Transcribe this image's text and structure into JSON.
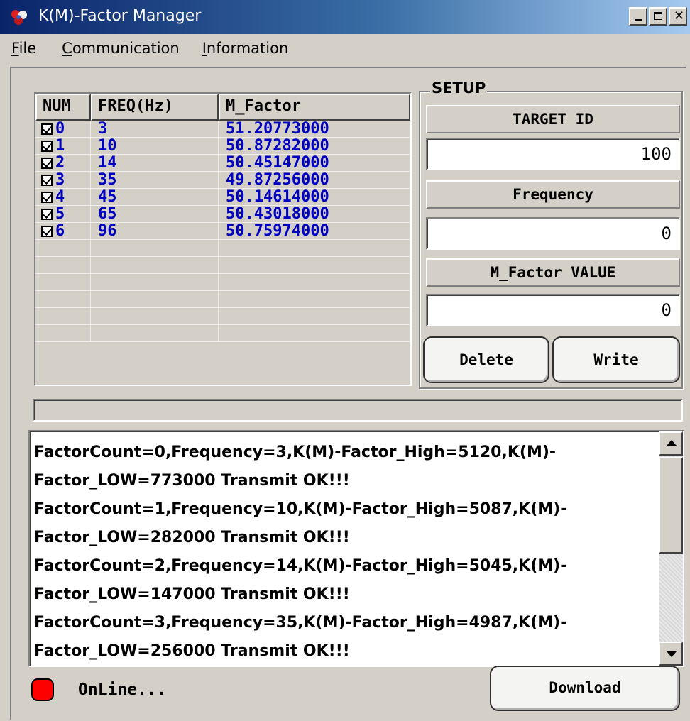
{
  "window": {
    "title": "K(M)-Factor Manager"
  },
  "menu": [
    {
      "label": "File"
    },
    {
      "label": "Communication"
    },
    {
      "label": "Information"
    }
  ],
  "grid": {
    "headers": [
      "NUM",
      "FREQ(Hz)",
      "M_Factor"
    ],
    "rows": [
      {
        "num": "0",
        "freq": "3",
        "factor": "51.20773000",
        "checked": true
      },
      {
        "num": "1",
        "freq": "10",
        "factor": "50.87282000",
        "checked": true
      },
      {
        "num": "2",
        "freq": "14",
        "factor": "50.45147000",
        "checked": true
      },
      {
        "num": "3",
        "freq": "35",
        "factor": "49.87256000",
        "checked": true
      },
      {
        "num": "4",
        "freq": "45",
        "factor": "50.14614000",
        "checked": true
      },
      {
        "num": "5",
        "freq": "65",
        "factor": "50.43018000",
        "checked": true
      },
      {
        "num": "6",
        "freq": "96",
        "factor": "50.75974000",
        "checked": true
      }
    ]
  },
  "setup": {
    "legend": "SETUP",
    "target_label": "TARGET ID",
    "target_value": "100",
    "frequency_label": "Frequency",
    "frequency_value": "0",
    "mfactor_label": "M_Factor VALUE",
    "mfactor_value": "0",
    "delete_label": "Delete",
    "write_label": "Write"
  },
  "progress": {
    "value": 0
  },
  "log": {
    "lines": [
      "FactorCount=0,Frequency=3,K(M)-Factor_High=5120,K(M)-",
      "Factor_LOW=773000 Transmit OK!!!",
      "FactorCount=1,Frequency=10,K(M)-Factor_High=5087,K(M)-",
      "Factor_LOW=282000 Transmit OK!!!",
      "FactorCount=2,Frequency=14,K(M)-Factor_High=5045,K(M)-",
      "Factor_LOW=147000 Transmit OK!!!",
      "FactorCount=3,Frequency=35,K(M)-Factor_High=4987,K(M)-",
      "Factor_LOW=256000 Transmit OK!!!"
    ]
  },
  "status": {
    "text": "OnLine...",
    "led_color": "#ff0000"
  },
  "download_label": "Download",
  "colors": {
    "titlebar": "#0a246a",
    "grid_text": "#0000c0",
    "face": "#d4d0c8"
  }
}
